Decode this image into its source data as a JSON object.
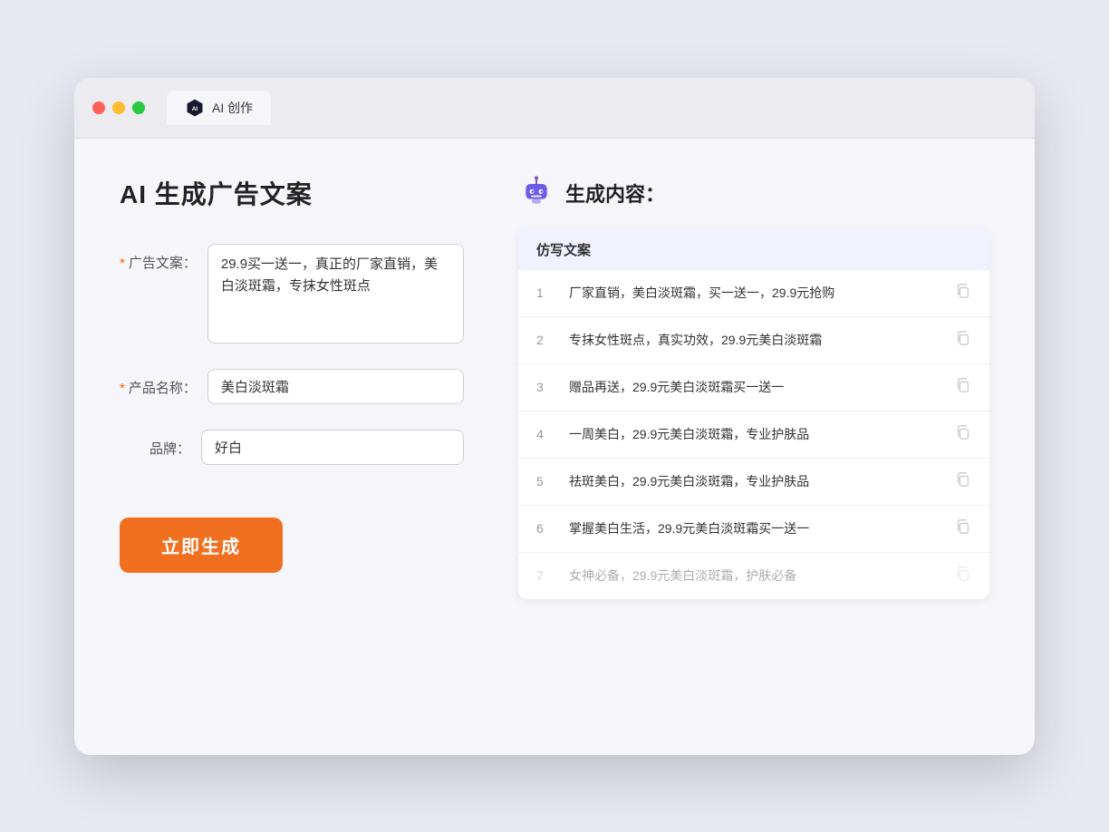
{
  "browser": {
    "tab_label": "AI 创作"
  },
  "page": {
    "title": "AI 生成广告文案"
  },
  "form": {
    "ad_copy_label": "广告文案：",
    "ad_copy_required": "*",
    "ad_copy_value": "29.9买一送一，真正的厂家直销，美白淡斑霜，专抹女性斑点",
    "product_name_label": "产品名称：",
    "product_name_required": "*",
    "product_name_value": "美白淡斑霜",
    "brand_label": "品牌：",
    "brand_value": "好白",
    "generate_button": "立即生成"
  },
  "result": {
    "header": "生成内容：",
    "column_label": "仿写文案",
    "items": [
      {
        "num": "1",
        "text": "厂家直销，美白淡斑霜，买一送一，29.9元抢购",
        "faded": false
      },
      {
        "num": "2",
        "text": "专抹女性斑点，真实功效，29.9元美白淡斑霜",
        "faded": false
      },
      {
        "num": "3",
        "text": "赠品再送，29.9元美白淡斑霜买一送一",
        "faded": false
      },
      {
        "num": "4",
        "text": "一周美白，29.9元美白淡斑霜，专业护肤品",
        "faded": false
      },
      {
        "num": "5",
        "text": "祛斑美白，29.9元美白淡斑霜，专业护肤品",
        "faded": false
      },
      {
        "num": "6",
        "text": "掌握美白生活，29.9元美白淡斑霜买一送一",
        "faded": false
      },
      {
        "num": "7",
        "text": "女神必备，29.9元美白淡斑霜，护肤必备",
        "faded": true
      }
    ]
  }
}
